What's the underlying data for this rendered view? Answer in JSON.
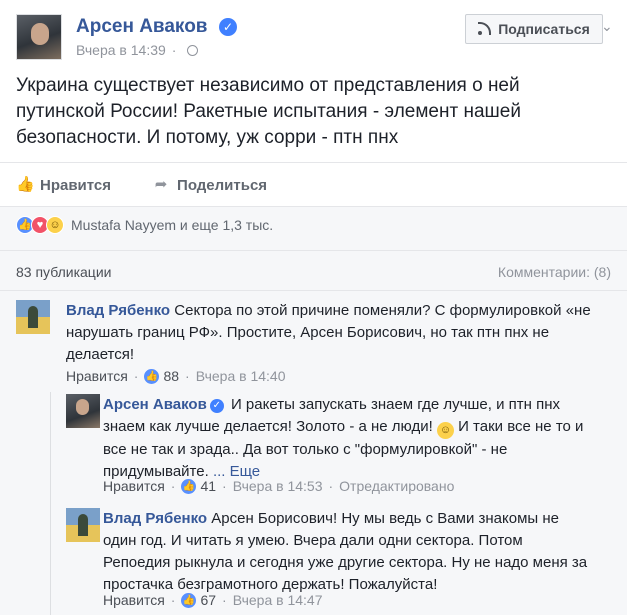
{
  "post": {
    "author": "Арсен Аваков",
    "verified_mark": "✓",
    "time": "Вчера в 14:39",
    "subscribe_label": "Подписаться",
    "chevron": "⌄",
    "text": "Украина существует независимо от представления о ней путинской России! Ракетные испытания - элемент нашей безопасности. И потому, уж сорри - птн пнх",
    "like_label": "Нравится",
    "share_label": "Поделиться",
    "like_glyph": "👍",
    "share_glyph": "➦",
    "reactions_text": "Mustafa Nayyem и еще 1,3 тыс.",
    "reaction_icons": [
      "like-icon",
      "love-icon",
      "haha-icon"
    ],
    "publications": "83 публикации",
    "comments_count": "Комментарии: (8)"
  },
  "comments": [
    {
      "author": "Влад Рябенко",
      "text": "Сектора по этой причине поменяли? С формулировкой «не нарушать границ РФ». Простите, Арсен Борисович, но так птн пнх не делается!",
      "like_label": "Нравится",
      "likes": "88",
      "time": "Вчера в 14:40"
    },
    {
      "author": "Арсен Аваков",
      "verified": true,
      "text_a": "И ракеты запускать знаем где лучше, и птн пнх знаем как лучше делается! Золото - а не люди!",
      "text_b": "И таки все не то и все не так и зрада.. Да вот только с \"формулировкой\" - не придумывайте.",
      "more": "... Еще",
      "like_label": "Нравится",
      "likes": "41",
      "time": "Вчера в 14:53",
      "edited": "Отредактировано"
    },
    {
      "author": "Влад Рябенко",
      "text": "Арсен Борисович! Ну мы ведь с Вами знакомы не один год. И читать я умею. Вчера дали одни сектора. Потом Репоедия рыкнула и сегодня уже другие сектора. Ну не надо меня за простачка безграмотного держать! Пожалуйста!",
      "like_label": "Нравится",
      "likes": "67",
      "time": "Вчера в 14:47"
    }
  ],
  "ui": {
    "dot": "·",
    "thumb": "👍",
    "smile": "☺"
  }
}
